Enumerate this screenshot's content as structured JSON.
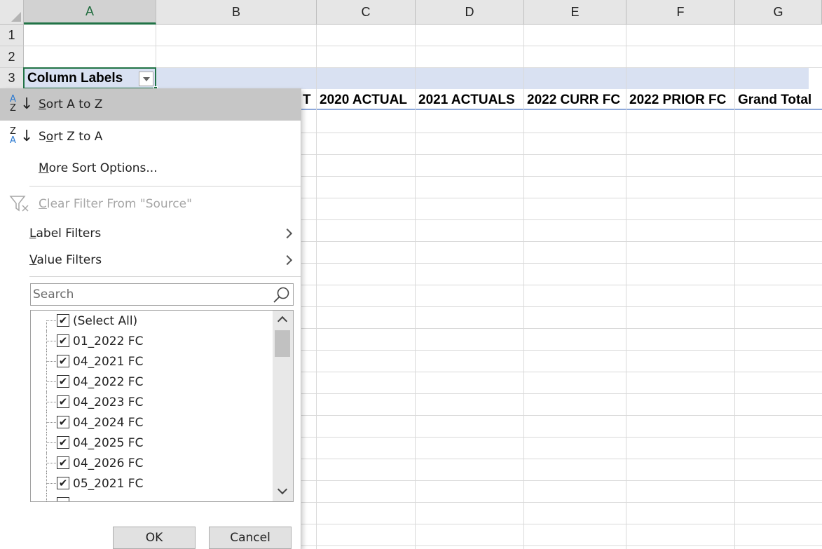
{
  "sheet": {
    "columns": [
      "A",
      "B",
      "C",
      "D",
      "E",
      "F",
      "G"
    ],
    "rows": [
      "1",
      "2",
      "3"
    ],
    "cell_a3": "Column Labels",
    "pivot_headers": {
      "b_fragment": "T",
      "c": "2020 ACTUAL",
      "d": "2021 ACTUALS",
      "e": "2022 CURR FC",
      "f": "2022 PRIOR FC",
      "g": "Grand Total"
    }
  },
  "filter_menu": {
    "sort_asc": {
      "pre": "",
      "accel": "S",
      "post": "ort A to Z",
      "icon_top": "A",
      "icon_bottom": "Z"
    },
    "sort_desc": {
      "pre": "S",
      "accel": "o",
      "post": "rt Z to A",
      "icon_top": "Z",
      "icon_bottom": "A"
    },
    "more_sort": {
      "pre": "",
      "accel": "M",
      "post": "ore Sort Options..."
    },
    "clear_filter": {
      "pre": "",
      "accel": "C",
      "post": "lear Filter From \"Source\""
    },
    "label_filters": {
      "pre": "",
      "accel": "L",
      "post": "abel Filters"
    },
    "value_filters": {
      "pre": "",
      "accel": "V",
      "post": "alue Filters"
    },
    "search_placeholder": "Search",
    "items": [
      {
        "label": "(Select All)",
        "checked": true
      },
      {
        "label": "01_2022 FC",
        "checked": true
      },
      {
        "label": "04_2021 FC",
        "checked": true
      },
      {
        "label": "04_2022 FC",
        "checked": true
      },
      {
        "label": "04_2023 FC",
        "checked": true
      },
      {
        "label": "04_2024 FC",
        "checked": true
      },
      {
        "label": "04_2025 FC",
        "checked": true
      },
      {
        "label": "04_2026 FC",
        "checked": true
      },
      {
        "label": "05_2021 FC",
        "checked": true
      }
    ],
    "checkmark": "✔",
    "ok_label": "OK",
    "cancel_label": "Cancel"
  },
  "colors": {
    "accent": "#217346",
    "pivot_header_fill": "#d9e1f2",
    "menu_hover": "#c6c6c6",
    "disabled_text": "#a6a6a6",
    "sort_icon_blue": "#2b79d0"
  }
}
